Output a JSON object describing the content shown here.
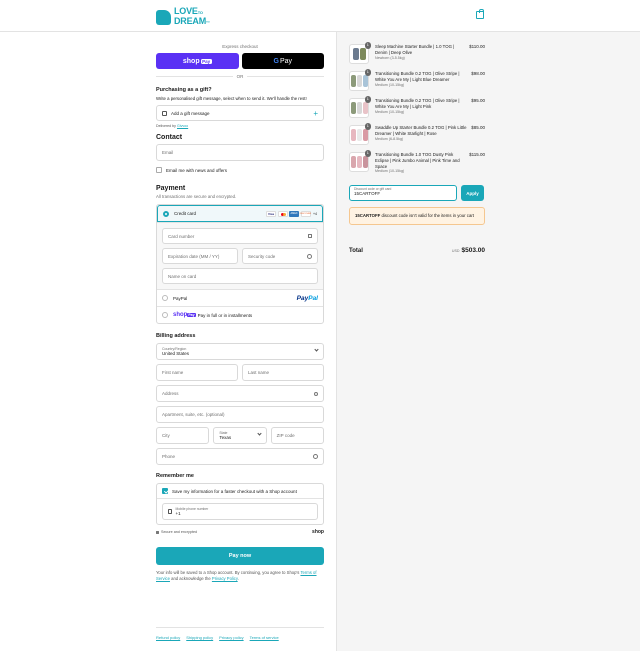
{
  "brand": {
    "name_line1": "LOVE",
    "name_to": "TO",
    "name_line2": "DREAM",
    "tm": "™",
    "accent": "#1aa7b8"
  },
  "express": {
    "title": "Express checkout",
    "shop_pay_label": "shop",
    "shop_pay_badge": "Pay",
    "gpay_g": "G",
    "gpay_label": "Pay",
    "or": "OR"
  },
  "gift": {
    "heading": "Purchasing as a gift?",
    "description": "Write a personalised gift message, select when to send it. We'll handle the rest!",
    "button_label": "Add a gift message",
    "delivered_prefix": "Delivered by",
    "delivered_link": "Givvoo"
  },
  "contact": {
    "heading": "Contact",
    "email_placeholder": "Email",
    "newsletter_label": "Email me with news and offers"
  },
  "payment": {
    "heading": "Payment",
    "subtitle": "All transactions are secure and encrypted.",
    "credit_card_label": "Credit card",
    "card_brands": [
      "Visa",
      "MC",
      "AMEX",
      "DISCOVER"
    ],
    "more_cards": "+4",
    "card_number_placeholder": "Card number",
    "expiry_placeholder": "Expiration date (MM / YY)",
    "security_placeholder": "Security code",
    "name_placeholder": "Name on card",
    "paypal_label": "PayPal",
    "paypal_logo_a": "Pay",
    "paypal_logo_b": "Pal",
    "shoppay_label": "Pay in full or in installments",
    "shoppay_logo": "shop",
    "shoppay_badge": "Pay"
  },
  "billing": {
    "heading": "Billing address",
    "country_label": "Country/Region",
    "country_value": "United States",
    "first_name": "First name",
    "last_name": "Last name",
    "address": "Address",
    "apartment": "Apartment, suite, etc. (optional)",
    "city": "City",
    "state_label": "State",
    "state_value": "Texas",
    "zip": "ZIP code",
    "phone": "Phone"
  },
  "remember": {
    "heading": "Remember me",
    "save_label": "Save my information for a faster checkout with a Shop account",
    "mobile_label": "Mobile phone number",
    "mobile_value": "+1",
    "secure_text": "Secure and encrypted",
    "shop_word": "shop"
  },
  "pay_now": "Pay now",
  "disclaimer": {
    "text1": "Your info will be saved to a Shop account. By continuing, you agree to Shop's",
    "terms_link": "Terms of Service",
    "text2": "and acknowledge the",
    "privacy_link": "Privacy Policy",
    "text3": "."
  },
  "footer": [
    "Refund policy",
    "Shipping policy",
    "Privacy policy",
    "Terms of service"
  ],
  "cart": {
    "items": [
      {
        "qty": "1",
        "title": "Sleep Machine Starter Bundle | 1.0 TOG | Denim | Deep Olive",
        "variant": "Newborn (3-5.5kg)",
        "price": "$110.00",
        "colors": [
          "#6b7a8f",
          "#7d8a5c"
        ]
      },
      {
        "qty": "1",
        "title": "Transitioning Bundle 0.2 TOG | Olive Stripe | White You Are My | Light Blue Dreamer",
        "variant": "Medium (10-15kg)",
        "price": "$98.00",
        "colors": [
          "#8c9a7a",
          "#d8d8d8",
          "#a9c4d8"
        ]
      },
      {
        "qty": "1",
        "title": "Transitioning Bundle 0.2 TOG | Olive Stripe | White You Are My | Light Pink",
        "variant": "Medium (10-15kg)",
        "price": "$95.00",
        "colors": [
          "#8c9a7a",
          "#d8d8d8",
          "#e9c3c8"
        ]
      },
      {
        "qty": "1",
        "title": "Swaddle Up Starter Bundle 0.2 TOG | Pink Little Dreamer | White Starlight | Rose",
        "variant": "Medium (6-8.5kg)",
        "price": "$85.00",
        "colors": [
          "#e7b7bf",
          "#e9e9e9",
          "#d99aa4"
        ]
      },
      {
        "qty": "1",
        "title": "Transitioning Bundle 1.0 TOG Dusty Pink Eclipse | Pink Jumbo Animal | Pink Time and Space",
        "variant": "Medium (10-15kg)",
        "price": "$115.00",
        "colors": [
          "#d9a6ad",
          "#e6b8c0",
          "#c9949d"
        ]
      }
    ],
    "discount_label": "Discount code or gift card",
    "discount_value": "15CARTOFF",
    "apply_label": "Apply",
    "error_code": "15CARTOFF",
    "error_text": "discount code isn't valid for the items in your cart",
    "total_label": "Total",
    "currency": "USD",
    "total_value": "$503.00"
  }
}
